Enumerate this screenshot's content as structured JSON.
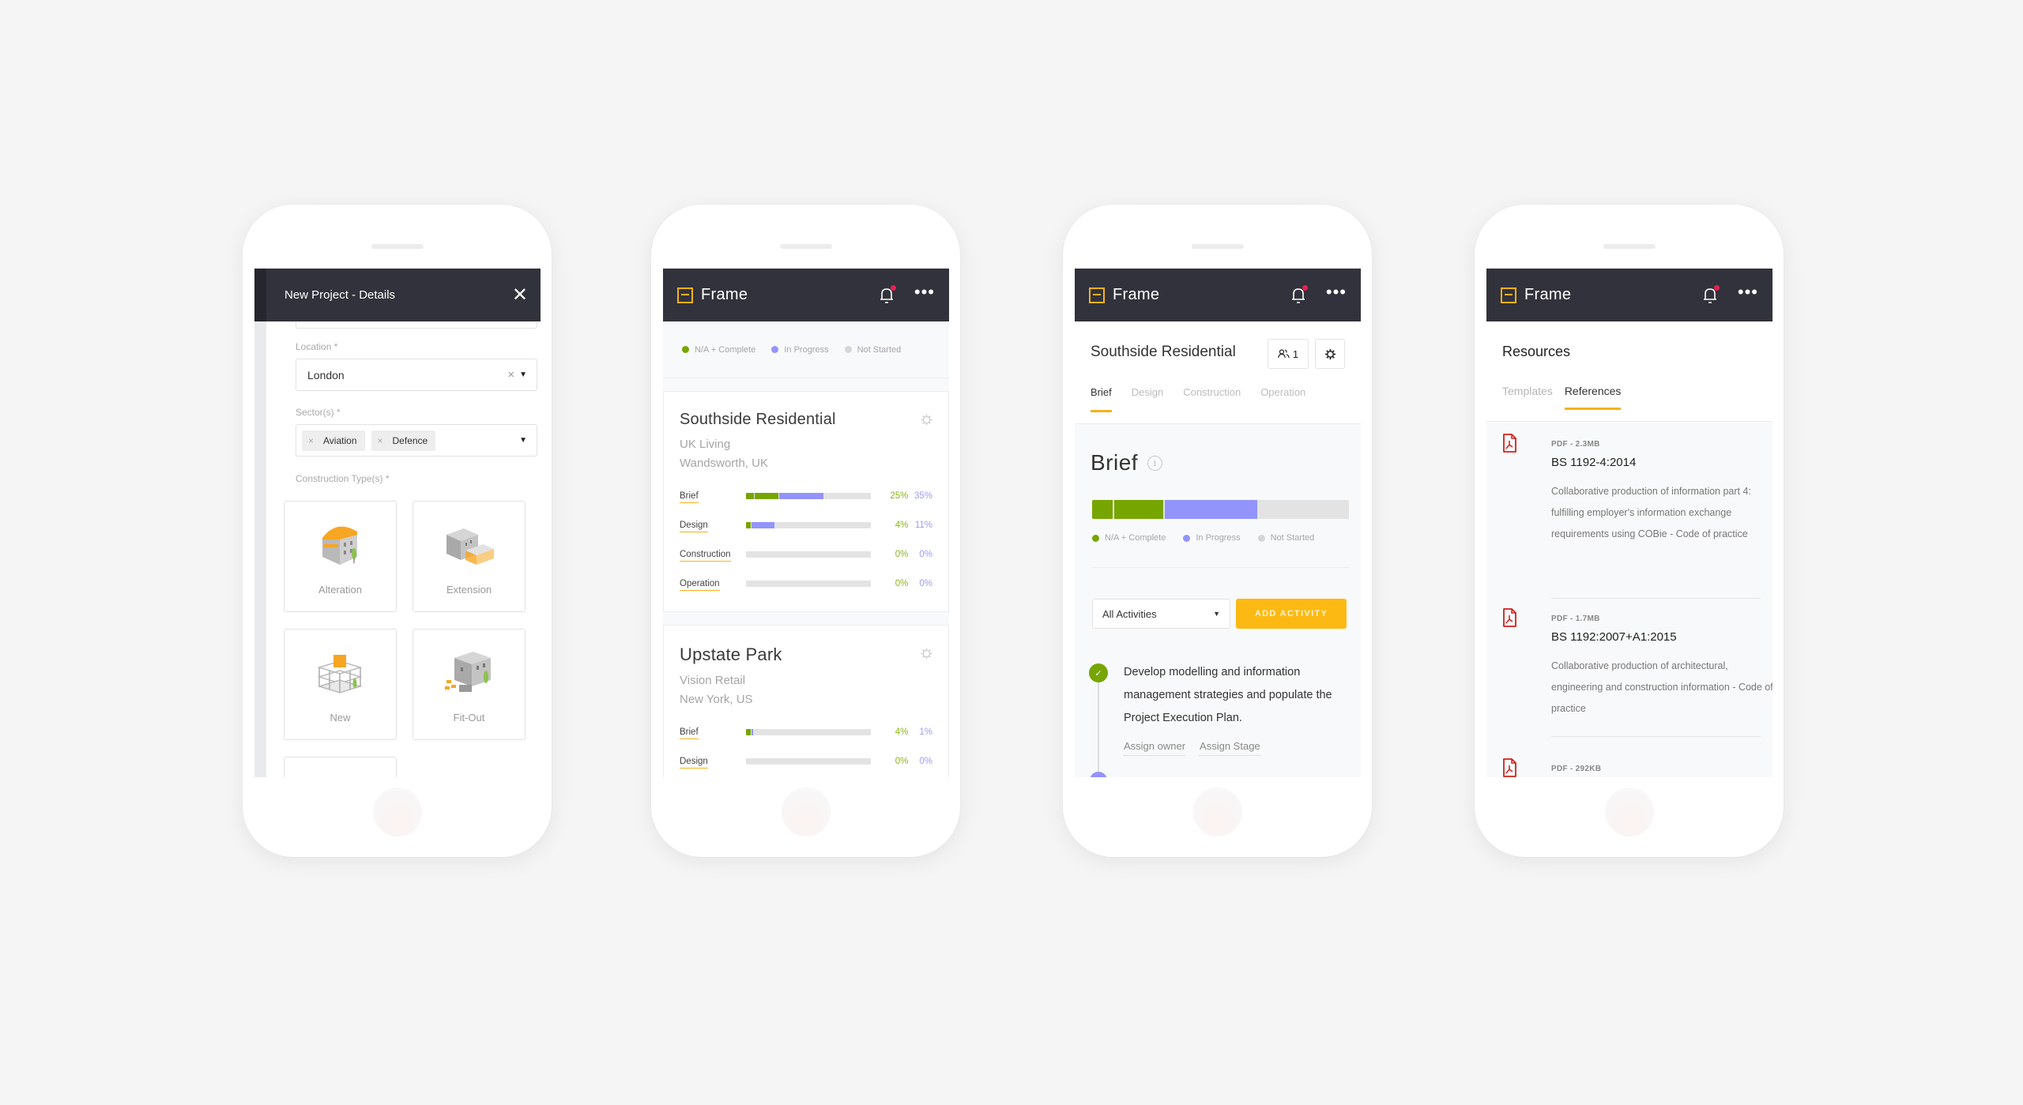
{
  "colors": {
    "background": "#f5f5f5",
    "appbar": "#32323c",
    "accent": "#f5b21c",
    "complete_green": "#77a500",
    "in_progress_purple": "#9394fb",
    "not_started_gray": "#d6d6d6",
    "notification_red": "#e8204f",
    "pdf_red": "#d0201c"
  },
  "phone1": {
    "header_title": "New Project - Details",
    "close_icon": "close-icon",
    "location": {
      "label": "Location *",
      "value": "London"
    },
    "sectors": {
      "label": "Sector(s) *",
      "chips": [
        "Aviation",
        "Defence"
      ]
    },
    "construction_types": {
      "label": "Construction Type(s) *",
      "options": [
        "Alteration",
        "Extension",
        "New",
        "Fit-Out"
      ]
    }
  },
  "app": {
    "brand": "Frame",
    "bell_icon": "bell-icon",
    "more_icon": "more-icon",
    "has_notification": true
  },
  "legend": [
    "N/A + Complete",
    "In Progress",
    "Not Started"
  ],
  "phone2": {
    "projects": [
      {
        "name": "Southside Residential",
        "client": "UK Living",
        "location": "Wandsworth, UK",
        "stages": [
          {
            "name": "Brief",
            "na_pct": 6,
            "complete_pct": 19,
            "complete_label": "25%",
            "progress_pct": 35,
            "progress_label": "35%"
          },
          {
            "name": "Design",
            "na_pct": 0,
            "complete_pct": 4,
            "complete_label": "4%",
            "progress_pct": 18,
            "progress_label": "11%"
          },
          {
            "name": "Construction",
            "na_pct": 0,
            "complete_pct": 0,
            "complete_label": "0%",
            "progress_pct": 0,
            "progress_label": "0%"
          },
          {
            "name": "Operation",
            "na_pct": 0,
            "complete_pct": 0,
            "complete_label": "0%",
            "progress_pct": 0,
            "progress_label": "0%"
          }
        ]
      },
      {
        "name": "Upstate Park",
        "client": "Vision Retail",
        "location": "New York, US",
        "stages": [
          {
            "name": "Brief",
            "na_pct": 0,
            "complete_pct": 4,
            "complete_label": "4%",
            "progress_pct": 1,
            "progress_label": "1%"
          },
          {
            "name": "Design",
            "na_pct": 0,
            "complete_pct": 0,
            "complete_label": "0%",
            "progress_pct": 0,
            "progress_label": "0%"
          }
        ]
      }
    ]
  },
  "phone3": {
    "project_title": "Southside Residential",
    "members_count": "1",
    "tabs": [
      "Brief",
      "Design",
      "Construction",
      "Operation"
    ],
    "active_tab": "Brief",
    "stage_title": "Brief",
    "progress": {
      "na_pct": 8,
      "complete_pct": 19,
      "in_progress_pct": 36
    },
    "filter_value": "All Activities",
    "add_activity_label": "ADD ACTIVITY",
    "activities": [
      {
        "text": "Develop modelling and information management strategies and populate the Project Execution Plan.",
        "status": "complete",
        "links": [
          "Assign owner",
          "Assign Stage"
        ]
      }
    ]
  },
  "phone4": {
    "title": "Resources",
    "tabs": [
      "Templates",
      "References"
    ],
    "active_tab": "References",
    "documents": [
      {
        "meta": "PDF - 2.3MB",
        "title": "BS 1192-4:2014",
        "description": "Collaborative production of information part 4: fulfilling employer's information exchange requirements using COBie - Code of practice"
      },
      {
        "meta": "PDF - 1.7MB",
        "title": "BS 1192:2007+A1:2015",
        "description": "Collaborative production of architectural, engineering and construction information - Code of practice"
      },
      {
        "meta": "PDF - 292KB",
        "title": "",
        "description": ""
      }
    ]
  }
}
